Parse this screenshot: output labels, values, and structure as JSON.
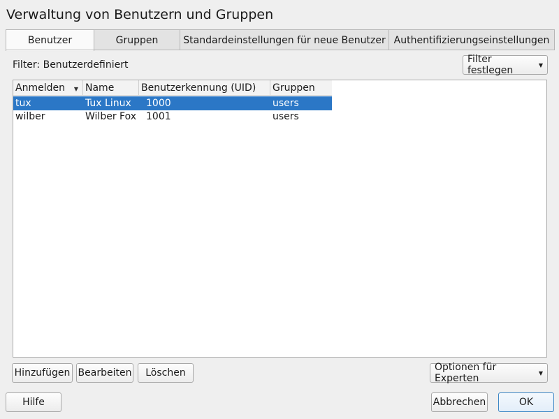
{
  "window": {
    "title": "Verwaltung von Benutzern und Gruppen"
  },
  "tabs": [
    {
      "label": "Benutzer"
    },
    {
      "label": "Gruppen"
    },
    {
      "label": "Standardeinstellungen für neue Benutzer"
    },
    {
      "label": "Authentifizierungseinstellungen"
    }
  ],
  "filter": {
    "label": "Filter: Benutzerdefiniert",
    "button_label": "Filter festlegen"
  },
  "table": {
    "columns": [
      "Anmelden",
      "Name",
      "Benutzerkennung (UID)",
      "Gruppen"
    ],
    "rows": [
      {
        "login": "tux",
        "name": "Tux Linux",
        "uid": "1000",
        "groups": "users",
        "selected": true
      },
      {
        "login": "wilber",
        "name": "Wilber Fox",
        "uid": "1001",
        "groups": "users",
        "selected": false
      }
    ]
  },
  "actions": {
    "add_label": "Hinzufügen",
    "edit_label": "Bearbeiten",
    "delete_label": "Löschen",
    "expert_label": "Optionen für Experten"
  },
  "footer": {
    "help_label": "Hilfe",
    "cancel_label": "Abbrechen",
    "ok_label": "OK"
  },
  "icons": {
    "sort": "sort-descending-icon",
    "dropdown": "chevron-down-icon"
  },
  "colors": {
    "selection": "#2b77c6",
    "background": "#efefef"
  }
}
